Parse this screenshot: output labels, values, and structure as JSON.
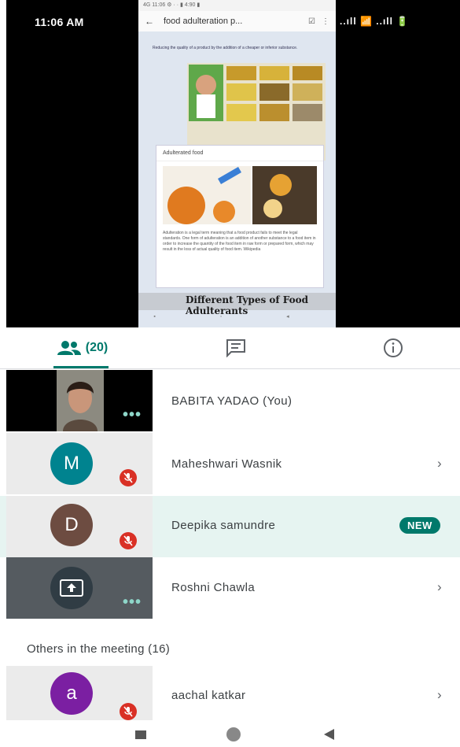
{
  "status_bar": {
    "time": "11:06 AM",
    "right_icons": "..ıll 📶 ..ıll 🔋"
  },
  "shared_screen": {
    "status": "4G 11:06 ⚙ ·  ·                             ▮ 4:90 ▮",
    "url": "food adulteration p...",
    "caption": "Reducing the quality of a product by the addition of a cheaper or inferior substance.",
    "card_title": "Adulterated food",
    "card_text": "Adulteration is a legal term meaning that a food product fails to meet the legal standards. One form of adulteration is an addition of another substance to a food item in order to increase the quantity of the food item in raw form or prepared form, which may result in the loss of actual quality of food item. Wikipedia",
    "slide_title": "Different Types of Food Adulterants"
  },
  "tabs": {
    "people_count": "(20)"
  },
  "participants": [
    {
      "name": "BABITA YADAO (You)"
    },
    {
      "name": "Maheshwari Wasnik",
      "initial": "M",
      "color": "#00838f"
    },
    {
      "name": "Deepika samundre",
      "initial": "D",
      "color": "#6d4c41",
      "badge": "NEW"
    },
    {
      "name": "Roshni Chawla"
    }
  ],
  "others_header": "Others in the meeting (16)",
  "others": [
    {
      "name": "aachal katkar",
      "initial": "a",
      "color": "#7b1fa2"
    }
  ],
  "colors": {
    "accent": "#00796b",
    "mute_red": "#d93025",
    "highlight_row": "#e6f4f1"
  },
  "icons": [
    "people-icon",
    "chat-icon",
    "info-icon",
    "mic-off-icon",
    "present-screen-icon",
    "chevron-right-icon",
    "more-dots-icon"
  ]
}
